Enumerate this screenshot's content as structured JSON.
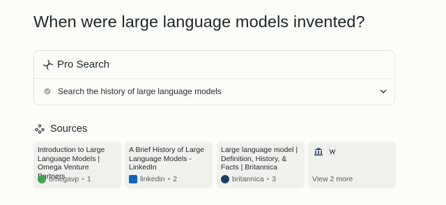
{
  "question": "When were large language models invented?",
  "pro_search": {
    "title": "Pro Search",
    "step": "Search the history of large language models"
  },
  "sources": {
    "title": "Sources",
    "cards": [
      {
        "title": "Introduction to Large Language Models | Omega Venture Partners",
        "site": "omegavp",
        "index": "1",
        "favicon": "omegavp-icon",
        "color": "#3fa34d"
      },
      {
        "title": "A Brief History of Large Language Models - LinkedIn",
        "site": "linkedin",
        "index": "2",
        "favicon": "linkedin-icon",
        "color": "#0a66c2"
      },
      {
        "title": "Large language model | Definition, History, & Facts | Britannica",
        "site": "britannica",
        "index": "3",
        "favicon": "britannica-icon",
        "color": "#1b3c66"
      }
    ],
    "more": "View 2 more"
  }
}
